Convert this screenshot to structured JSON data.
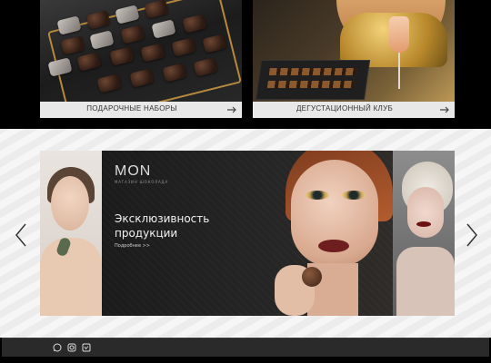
{
  "cards": [
    {
      "label": "ПОДАРОЧНЫЕ НАБОРЫ",
      "arrow_icon": "arrow-right-icon"
    },
    {
      "label": "ДЕГУСТАЦИОННЫЙ КЛУБ",
      "arrow_icon": "arrow-right-icon"
    }
  ],
  "banner": {
    "brand": "MON",
    "brand_sub": "МАГАЗИН ШОКОЛАДА",
    "headline_line1": "Эксклюзивность",
    "headline_line2": "продукции",
    "more": "Подробнее >>",
    "prev_icon": "chevron-left-icon",
    "next_icon": "chevron-right-icon"
  },
  "footer": {
    "social_icons": [
      "whatsapp-icon",
      "instagram-icon",
      "vk-icon"
    ]
  }
}
